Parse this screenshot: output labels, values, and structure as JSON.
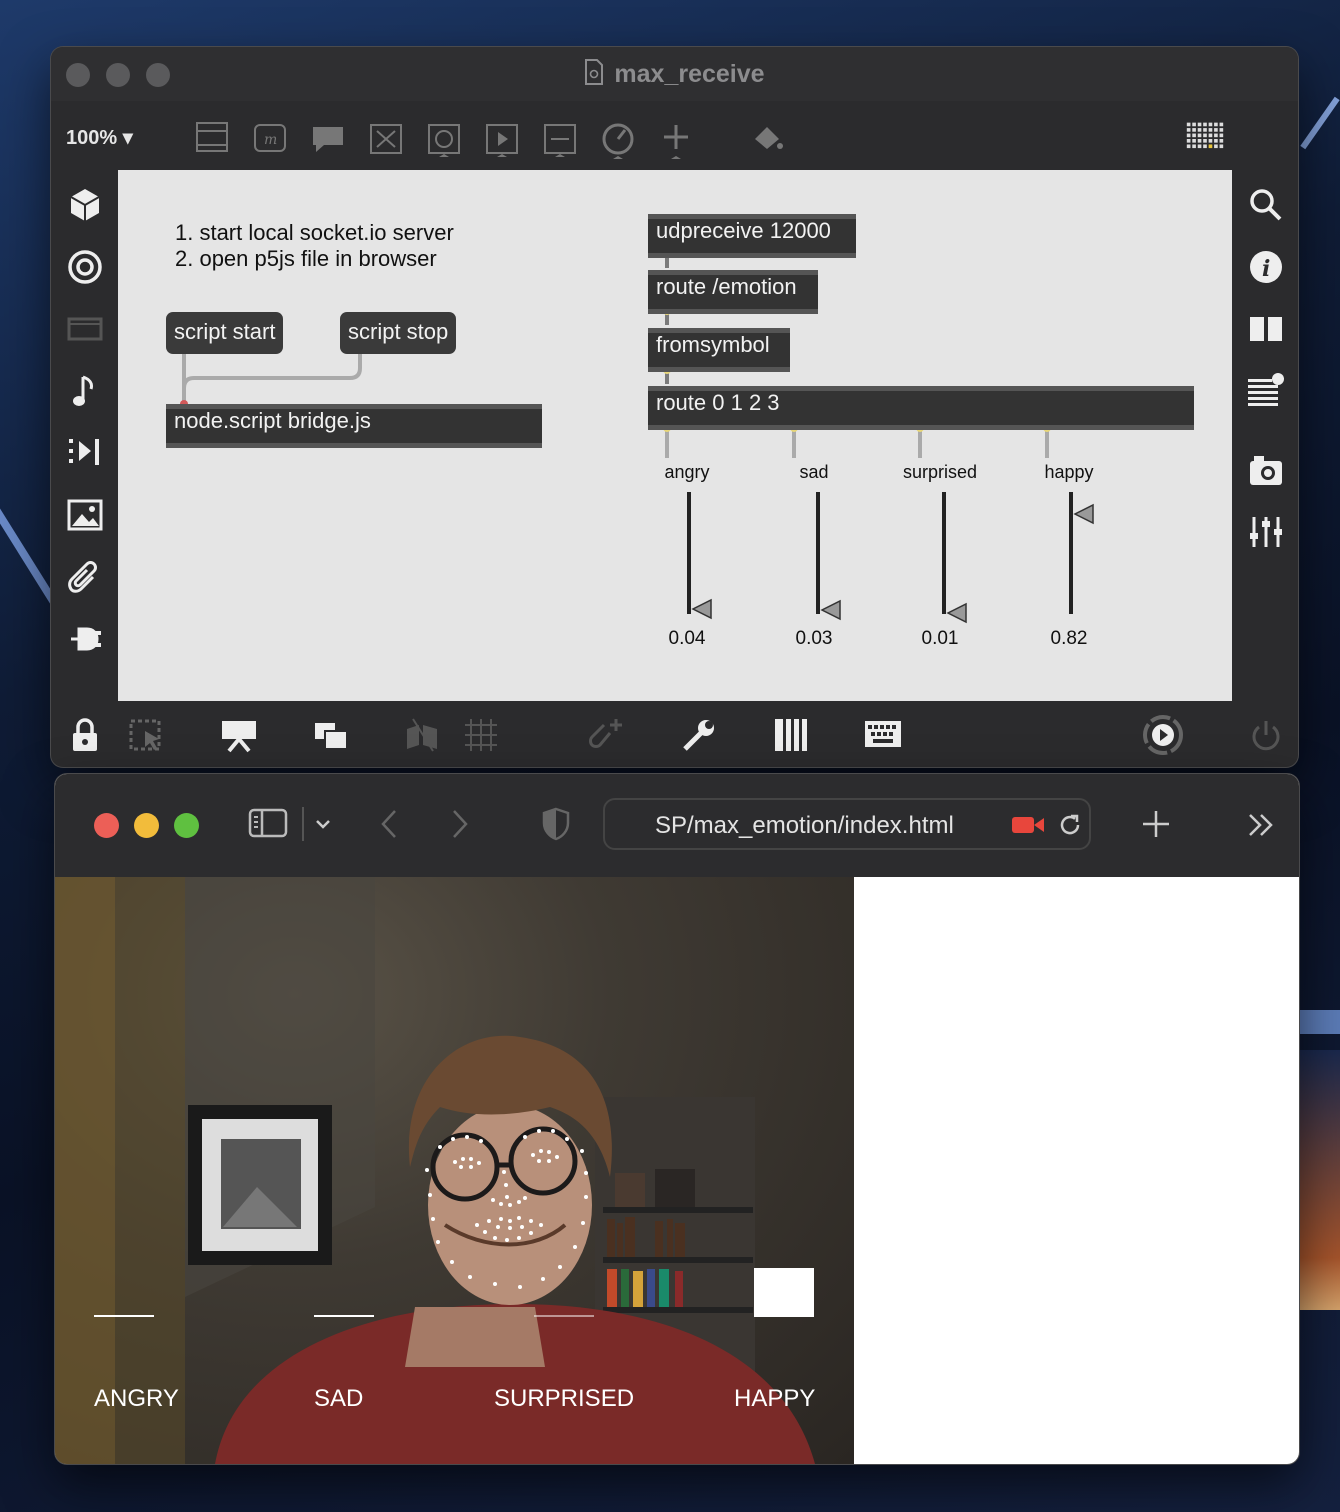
{
  "max": {
    "title": "max_receive",
    "zoom": "100% ▾",
    "comment_lines": [
      "1. start local socket.io server",
      "2. open p5js file in browser"
    ],
    "messages": {
      "start": "script start",
      "stop": "script stop"
    },
    "objects": {
      "node": "node.script bridge.js",
      "udp": "udpreceive 12000",
      "route_emotion": "route /emotion",
      "fromsymbol": "fromsymbol",
      "route_nums": "route 0 1 2 3"
    },
    "sliders": [
      {
        "label": "angry",
        "value_text": "0.04",
        "value": 0.04
      },
      {
        "label": "sad",
        "value_text": "0.03",
        "value": 0.03
      },
      {
        "label": "surprised",
        "value_text": "0.01",
        "value": 0.01
      },
      {
        "label": "happy",
        "value_text": "0.82",
        "value": 0.82
      }
    ]
  },
  "browser": {
    "url": "SP/max_emotion/index.html",
    "emotions": [
      {
        "label": "ANGRY",
        "value": 0.04
      },
      {
        "label": "SAD",
        "value": 0.03
      },
      {
        "label": "SURPRISED",
        "value": 0.01
      },
      {
        "label": "HAPPY",
        "value": 0.82
      }
    ]
  },
  "colors": {
    "tl_red": "#ec5f57",
    "tl_yellow": "#f2bc3b",
    "tl_green": "#5fc040",
    "record": "#e8463c"
  }
}
